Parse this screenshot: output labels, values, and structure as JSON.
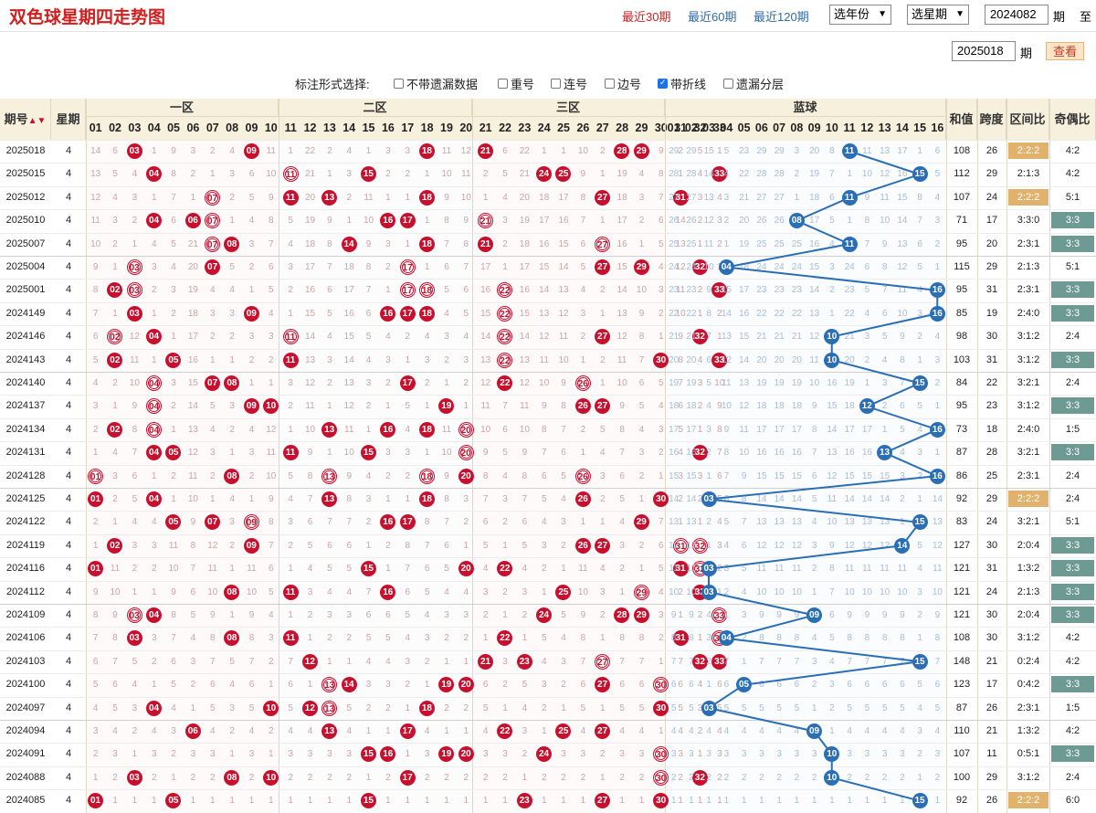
{
  "header": {
    "title": "双色球星期四走势图",
    "links": [
      {
        "label": "最近30期",
        "active": true
      },
      {
        "label": "最近60期",
        "active": false
      },
      {
        "label": "最近120期",
        "active": false
      }
    ],
    "year_select": "选年份",
    "week_select": "选星期",
    "from_period": "2024082",
    "period_unit": "期",
    "to_label": "至",
    "to_period": "2025018",
    "query_button": "查看"
  },
  "options": {
    "label": "标注形式选择:",
    "items": [
      {
        "label": "不带遗漏数据",
        "checked": false
      },
      {
        "label": "重号",
        "checked": false
      },
      {
        "label": "连号",
        "checked": false
      },
      {
        "label": "边号",
        "checked": false
      },
      {
        "label": "带折线",
        "checked": true
      },
      {
        "label": "遗漏分层",
        "checked": false
      }
    ]
  },
  "columns": {
    "period": "期号",
    "week": "星期",
    "zone1": "一区",
    "zone2": "二区",
    "zone3": "三区",
    "blue": "蓝球",
    "sum": "和值",
    "span": "跨度",
    "zone_ratio": "区间比",
    "odd_even": "奇偶比"
  },
  "rows": [
    {
      "period": "2025018",
      "week": "4",
      "red": [
        3,
        9,
        18,
        21,
        28,
        29
      ],
      "blue": 11,
      "sum": "108",
      "span": "26",
      "zr": "2:2:2",
      "oe": "4:2",
      "zr_hl": true,
      "oe_hl": false
    },
    {
      "period": "2025015",
      "week": "4",
      "red": [
        4,
        11,
        15,
        24,
        25,
        33
      ],
      "blue": 15,
      "sum": "112",
      "span": "29",
      "zr": "2:1:3",
      "oe": "4:2",
      "zr_hl": false,
      "oe_hl": false
    },
    {
      "period": "2025012",
      "week": "4",
      "red": [
        7,
        11,
        13,
        18,
        27,
        31
      ],
      "blue": 11,
      "sum": "107",
      "span": "24",
      "zr": "2:2:2",
      "oe": "5:1",
      "zr_hl": true,
      "oe_hl": false
    },
    {
      "period": "2025010",
      "week": "4",
      "red": [
        4,
        6,
        7,
        16,
        17,
        21
      ],
      "blue": 8,
      "sum": "71",
      "span": "17",
      "zr": "3:3:0",
      "oe": "3:3",
      "zr_hl": false,
      "oe_hl": true
    },
    {
      "period": "2025007",
      "week": "4",
      "red": [
        7,
        8,
        14,
        18,
        21,
        27
      ],
      "blue": 11,
      "sum": "95",
      "span": "20",
      "zr": "2:3:1",
      "oe": "3:3",
      "zr_hl": false,
      "oe_hl": true
    },
    {
      "period": "2025004",
      "week": "4",
      "red": [
        3,
        7,
        17,
        27,
        29,
        32
      ],
      "blue": 4,
      "sum": "115",
      "span": "29",
      "zr": "2:1:3",
      "oe": "5:1",
      "zr_hl": false,
      "oe_hl": false
    },
    {
      "period": "2025001",
      "week": "4",
      "red": [
        2,
        3,
        17,
        18,
        22,
        33
      ],
      "blue": 16,
      "sum": "95",
      "span": "31",
      "zr": "2:3:1",
      "oe": "3:3",
      "zr_hl": false,
      "oe_hl": true
    },
    {
      "period": "2024149",
      "week": "4",
      "red": [
        3,
        9,
        16,
        17,
        18,
        22
      ],
      "blue": 16,
      "sum": "85",
      "span": "19",
      "zr": "2:4:0",
      "oe": "3:3",
      "zr_hl": false,
      "oe_hl": true
    },
    {
      "period": "2024146",
      "week": "4",
      "red": [
        2,
        4,
        11,
        22,
        27,
        32
      ],
      "blue": 10,
      "sum": "98",
      "span": "30",
      "zr": "3:1:2",
      "oe": "2:4",
      "zr_hl": false,
      "oe_hl": false
    },
    {
      "period": "2024143",
      "week": "4",
      "red": [
        2,
        5,
        11,
        22,
        30,
        33
      ],
      "blue": 10,
      "sum": "103",
      "span": "31",
      "zr": "3:1:2",
      "oe": "3:3",
      "zr_hl": false,
      "oe_hl": true
    },
    {
      "period": "2024140",
      "week": "4",
      "red": [
        4,
        7,
        8,
        17,
        22,
        26
      ],
      "blue": 15,
      "sum": "84",
      "span": "22",
      "zr": "3:2:1",
      "oe": "2:4",
      "zr_hl": false,
      "oe_hl": false
    },
    {
      "period": "2024137",
      "week": "4",
      "red": [
        4,
        9,
        10,
        19,
        26,
        27
      ],
      "blue": 12,
      "sum": "95",
      "span": "23",
      "zr": "3:1:2",
      "oe": "3:3",
      "zr_hl": false,
      "oe_hl": true
    },
    {
      "period": "2024134",
      "week": "4",
      "red": [
        2,
        4,
        13,
        16,
        18,
        20
      ],
      "blue": 16,
      "sum": "73",
      "span": "18",
      "zr": "2:4:0",
      "oe": "1:5",
      "zr_hl": false,
      "oe_hl": false
    },
    {
      "period": "2024131",
      "week": "4",
      "red": [
        4,
        5,
        11,
        15,
        20,
        32
      ],
      "blue": 13,
      "sum": "87",
      "span": "28",
      "zr": "3:2:1",
      "oe": "3:3",
      "zr_hl": false,
      "oe_hl": true
    },
    {
      "period": "2024128",
      "week": "4",
      "red": [
        1,
        8,
        13,
        18,
        20,
        26
      ],
      "blue": 16,
      "sum": "86",
      "span": "25",
      "zr": "2:3:1",
      "oe": "2:4",
      "zr_hl": false,
      "oe_hl": false
    },
    {
      "period": "2024125",
      "week": "4",
      "red": [
        1,
        4,
        13,
        18,
        26,
        30
      ],
      "blue": 3,
      "sum": "92",
      "span": "29",
      "zr": "2:2:2",
      "oe": "2:4",
      "zr_hl": true,
      "oe_hl": false
    },
    {
      "period": "2024122",
      "week": "4",
      "red": [
        5,
        7,
        9,
        16,
        17,
        29
      ],
      "blue": 15,
      "sum": "83",
      "span": "24",
      "zr": "3:2:1",
      "oe": "5:1",
      "zr_hl": false,
      "oe_hl": false
    },
    {
      "period": "2024119",
      "week": "4",
      "red": [
        2,
        9,
        26,
        27,
        31,
        32
      ],
      "blue": 14,
      "sum": "127",
      "span": "30",
      "zr": "2:0:4",
      "oe": "3:3",
      "zr_hl": false,
      "oe_hl": true
    },
    {
      "period": "2024116",
      "week": "4",
      "red": [
        1,
        15,
        20,
        22,
        31,
        32
      ],
      "blue": 3,
      "sum": "121",
      "span": "31",
      "zr": "1:3:2",
      "oe": "3:3",
      "zr_hl": false,
      "oe_hl": true
    },
    {
      "period": "2024112",
      "week": "4",
      "red": [
        8,
        11,
        16,
        25,
        29,
        32
      ],
      "blue": 3,
      "sum": "121",
      "span": "24",
      "zr": "2:1:3",
      "oe": "3:3",
      "zr_hl": false,
      "oe_hl": true
    },
    {
      "period": "2024109",
      "week": "4",
      "red": [
        3,
        4,
        24,
        28,
        29,
        33
      ],
      "blue": 9,
      "sum": "121",
      "span": "30",
      "zr": "2:0:4",
      "oe": "3:3",
      "zr_hl": false,
      "oe_hl": true
    },
    {
      "period": "2024106",
      "week": "4",
      "red": [
        3,
        8,
        11,
        22,
        31,
        33
      ],
      "blue": 4,
      "sum": "108",
      "span": "30",
      "zr": "3:1:2",
      "oe": "4:2",
      "zr_hl": false,
      "oe_hl": false
    },
    {
      "period": "2024103",
      "week": "4",
      "red": [
        12,
        21,
        23,
        27,
        32,
        33
      ],
      "blue": 15,
      "sum": "148",
      "span": "21",
      "zr": "0:2:4",
      "oe": "4:2",
      "zr_hl": false,
      "oe_hl": false
    },
    {
      "period": "2024100",
      "week": "4",
      "red": [
        13,
        14,
        19,
        20,
        27,
        30
      ],
      "blue": 5,
      "sum": "123",
      "span": "17",
      "zr": "0:4:2",
      "oe": "3:3",
      "zr_hl": false,
      "oe_hl": true
    },
    {
      "period": "2024097",
      "week": "4",
      "red": [
        4,
        10,
        12,
        13,
        18,
        30
      ],
      "blue": 3,
      "sum": "87",
      "span": "26",
      "zr": "2:3:1",
      "oe": "1:5",
      "zr_hl": false,
      "oe_hl": false
    },
    {
      "period": "2024094",
      "week": "4",
      "red": [
        6,
        13,
        17,
        22,
        25,
        27
      ],
      "blue": 9,
      "sum": "110",
      "span": "21",
      "zr": "1:3:2",
      "oe": "4:2",
      "zr_hl": false,
      "oe_hl": false
    },
    {
      "period": "2024091",
      "week": "4",
      "red": [
        15,
        16,
        19,
        20,
        24,
        30
      ],
      "blue": 10,
      "sum": "107",
      "span": "11",
      "zr": "0:5:1",
      "oe": "3:3",
      "zr_hl": false,
      "oe_hl": true
    },
    {
      "period": "2024088",
      "week": "4",
      "red": [
        3,
        8,
        10,
        17,
        30,
        32
      ],
      "blue": 10,
      "sum": "100",
      "span": "29",
      "zr": "3:1:2",
      "oe": "2:4",
      "zr_hl": false,
      "oe_hl": false
    },
    {
      "period": "2024085",
      "week": "4",
      "red": [
        1,
        5,
        15,
        23,
        27,
        30
      ],
      "blue": 15,
      "sum": "92",
      "span": "26",
      "zr": "2:2:2",
      "oe": "6:0",
      "zr_hl": true,
      "oe_hl": false
    }
  ],
  "colors": {
    "red_ball": "#c8102e",
    "blue_ball": "#2a6fb5",
    "header_bg": "#f7f0dc",
    "ratio_hl": "#e0b26b",
    "oe_hl": "#6d9b94"
  }
}
